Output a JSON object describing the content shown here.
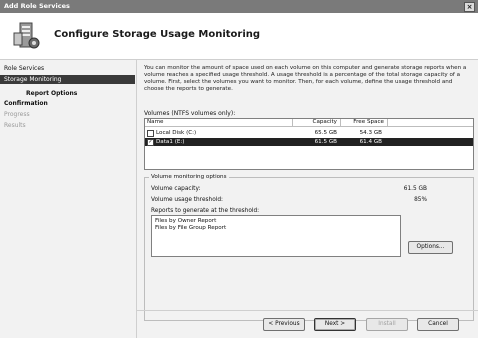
{
  "window": {
    "title": "Add Role Services",
    "close_glyph": "×"
  },
  "header": {
    "title": "Configure Storage Usage Monitoring"
  },
  "nav": {
    "items": [
      {
        "label": "Role Services"
      },
      {
        "label": "Storage Monitoring"
      },
      {
        "label": "Report Options"
      },
      {
        "label": "Confirmation"
      },
      {
        "label": "Progress"
      },
      {
        "label": "Results"
      }
    ]
  },
  "content": {
    "description": "You can monitor the amount of space used on each volume on this computer and generate storage reports when a volume reaches a specified usage threshold.  A usage threshold is a percentage of the total storage capacity of a volume. First, select the volumes you want to monitor.  Then, for each volume, define the usage threshold and choose the reports to generate.",
    "volumes_label": "Volumes (NTFS volumes only):",
    "columns": {
      "name": "Name",
      "capacity": "Capacity",
      "free_space": "Free Space"
    },
    "volumes": [
      {
        "name": "Local Disk (C:)",
        "capacity": "65.5 GB",
        "free_space": "54.3 GB",
        "checked": false
      },
      {
        "name": "Data1 (E:)",
        "capacity": "61.5 GB",
        "free_space": "61.4 GB",
        "checked": true
      }
    ],
    "options": {
      "legend": "Volume monitoring options",
      "capacity_label": "Volume capacity:",
      "capacity_value": "61.5 GB",
      "threshold_label": "Volume usage threshold:",
      "threshold_value": "85%",
      "reports_label": "Reports to generate at the threshold:",
      "reports": [
        "Files by Owner Report",
        "Files by File Group Report"
      ],
      "options_button": "Options..."
    }
  },
  "footer": {
    "previous": "< Previous",
    "next": "Next >",
    "install": "Install",
    "cancel": "Cancel"
  }
}
